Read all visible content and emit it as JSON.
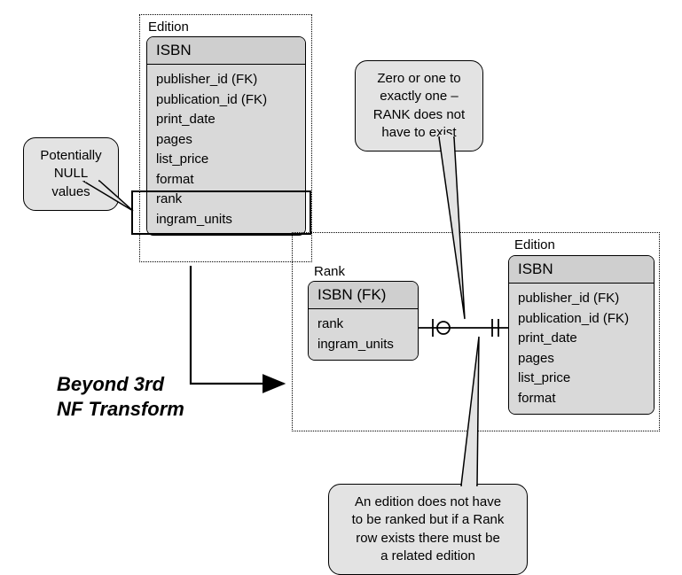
{
  "top": {
    "entity_label": "Edition",
    "header": "ISBN",
    "fields": [
      "publisher_id (FK)",
      "publication_id (FK)",
      "print_date",
      "pages",
      "list_price",
      "format",
      "rank",
      "ingram_units"
    ]
  },
  "bottom_left": {
    "entity_label": "Rank",
    "header": "ISBN (FK)",
    "fields": [
      "rank",
      "ingram_units"
    ]
  },
  "bottom_right": {
    "entity_label": "Edition",
    "header": "ISBN",
    "fields": [
      "publisher_id (FK)",
      "publication_id (FK)",
      "print_date",
      "pages",
      "list_price",
      "format"
    ]
  },
  "callouts": {
    "null_values": "Potentially\nNULL values",
    "zero_one": "Zero or one to\nexactly one –\nRANK does not\nhave to exist",
    "bottom": "An edition does not have\nto be ranked but if a Rank\nrow exists there must be\na related edition"
  },
  "transform_label": "Beyond 3rd\nNF Transform"
}
